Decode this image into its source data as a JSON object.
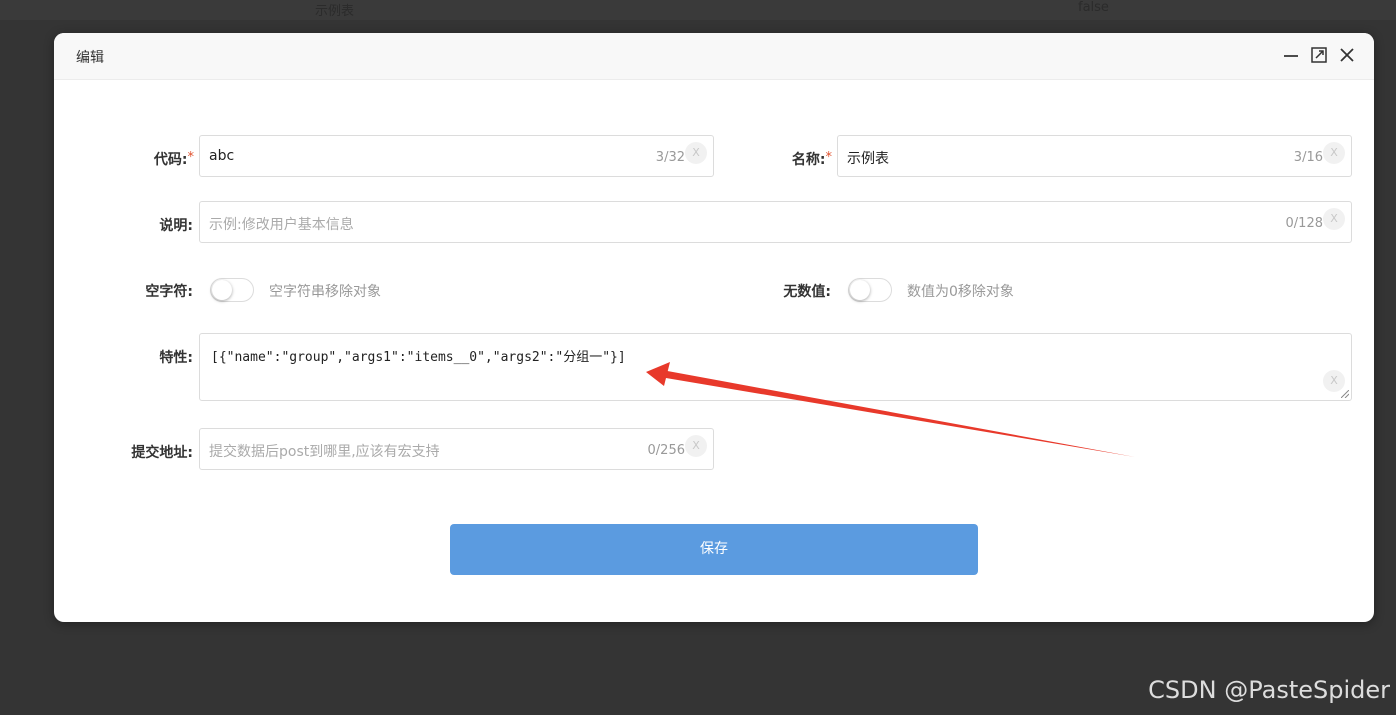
{
  "background": {
    "col1_text": "示例表",
    "col2_text": "false"
  },
  "dialog": {
    "title": "编辑",
    "controls": {
      "minimize": "minimize-icon",
      "maximize": "maximize-icon",
      "close": "close-icon"
    }
  },
  "form": {
    "code": {
      "label": "代码:",
      "value": "abc",
      "count": "3/32"
    },
    "name": {
      "label": "名称:",
      "value": "示例表",
      "count": "3/16"
    },
    "desc": {
      "label": "说明:",
      "placeholder": "示例:修改用户基本信息",
      "count": "0/128"
    },
    "empty_char": {
      "label": "空字符:",
      "switch_text": "空字符串移除对象",
      "on": false
    },
    "no_value": {
      "label": "无数值:",
      "switch_text": "数值为0移除对象",
      "on": false
    },
    "traits": {
      "label": "特性:",
      "value": "[{\"name\":\"group\",\"args1\":\"items__0\",\"args2\":\"分组一\"}]"
    },
    "submit_url": {
      "label": "提交地址:",
      "placeholder": "提交数据后post到哪里,应该有宏支持",
      "count": "0/256"
    },
    "required_mark": "*",
    "clear_glyph": "X"
  },
  "actions": {
    "save_label": "保存"
  },
  "annotation": {
    "arrow_color": "#e8392b"
  },
  "watermark": "CSDN @PasteSpider"
}
